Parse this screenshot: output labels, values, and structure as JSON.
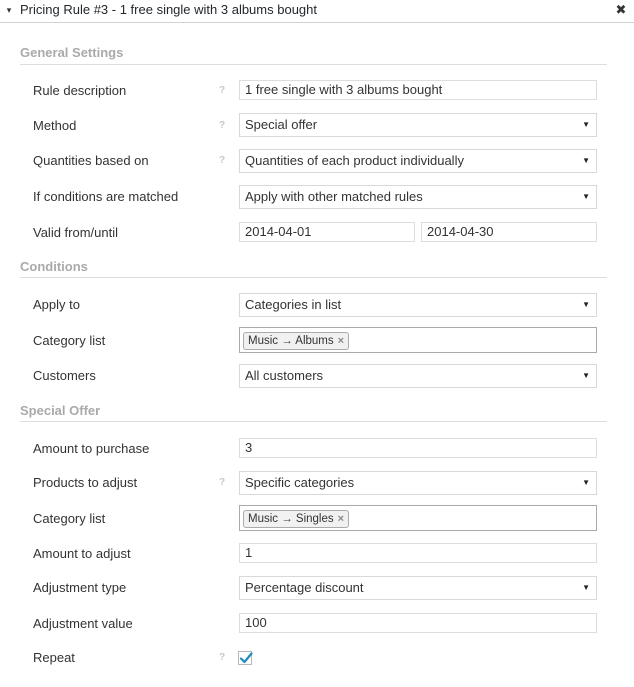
{
  "header": {
    "title": "Pricing Rule #3 - 1 free single with 3 albums bought",
    "toggle_icon": "▾",
    "close_icon": "✖"
  },
  "general": {
    "title": "General Settings",
    "rule_description": {
      "label": "Rule description",
      "value": "1 free single with 3 albums bought"
    },
    "method": {
      "label": "Method",
      "value": "Special offer"
    },
    "quantities": {
      "label": "Quantities based on",
      "value": "Quantities of each product individually"
    },
    "conditions_matched": {
      "label": "If conditions are matched",
      "value": "Apply with other matched rules"
    },
    "valid": {
      "label": "Valid from/until",
      "from": "2014-04-01",
      "until": "2014-04-30"
    }
  },
  "conditions": {
    "title": "Conditions",
    "apply_to": {
      "label": "Apply to",
      "value": "Categories in list"
    },
    "category_list": {
      "label": "Category list",
      "chip": "Music → Albums"
    },
    "customers": {
      "label": "Customers",
      "value": "All customers"
    }
  },
  "special_offer": {
    "title": "Special Offer",
    "amount_purchase": {
      "label": "Amount to purchase",
      "value": "3"
    },
    "products_adjust": {
      "label": "Products to adjust",
      "value": "Specific categories"
    },
    "category_list": {
      "label": "Category list",
      "chip": "Music → Singles"
    },
    "amount_adjust": {
      "label": "Amount to adjust",
      "value": "1"
    },
    "adjustment_type": {
      "label": "Adjustment type",
      "value": "Percentage discount"
    },
    "adjustment_value": {
      "label": "Adjustment value",
      "value": "100"
    },
    "repeat": {
      "label": "Repeat",
      "checked": true
    }
  },
  "help_mark": "?",
  "chip_remove": "×",
  "dropdown_arrow": "▼",
  "colors": {
    "section_title": "#aaaaaa",
    "checkmark": "#1e8cbe"
  }
}
